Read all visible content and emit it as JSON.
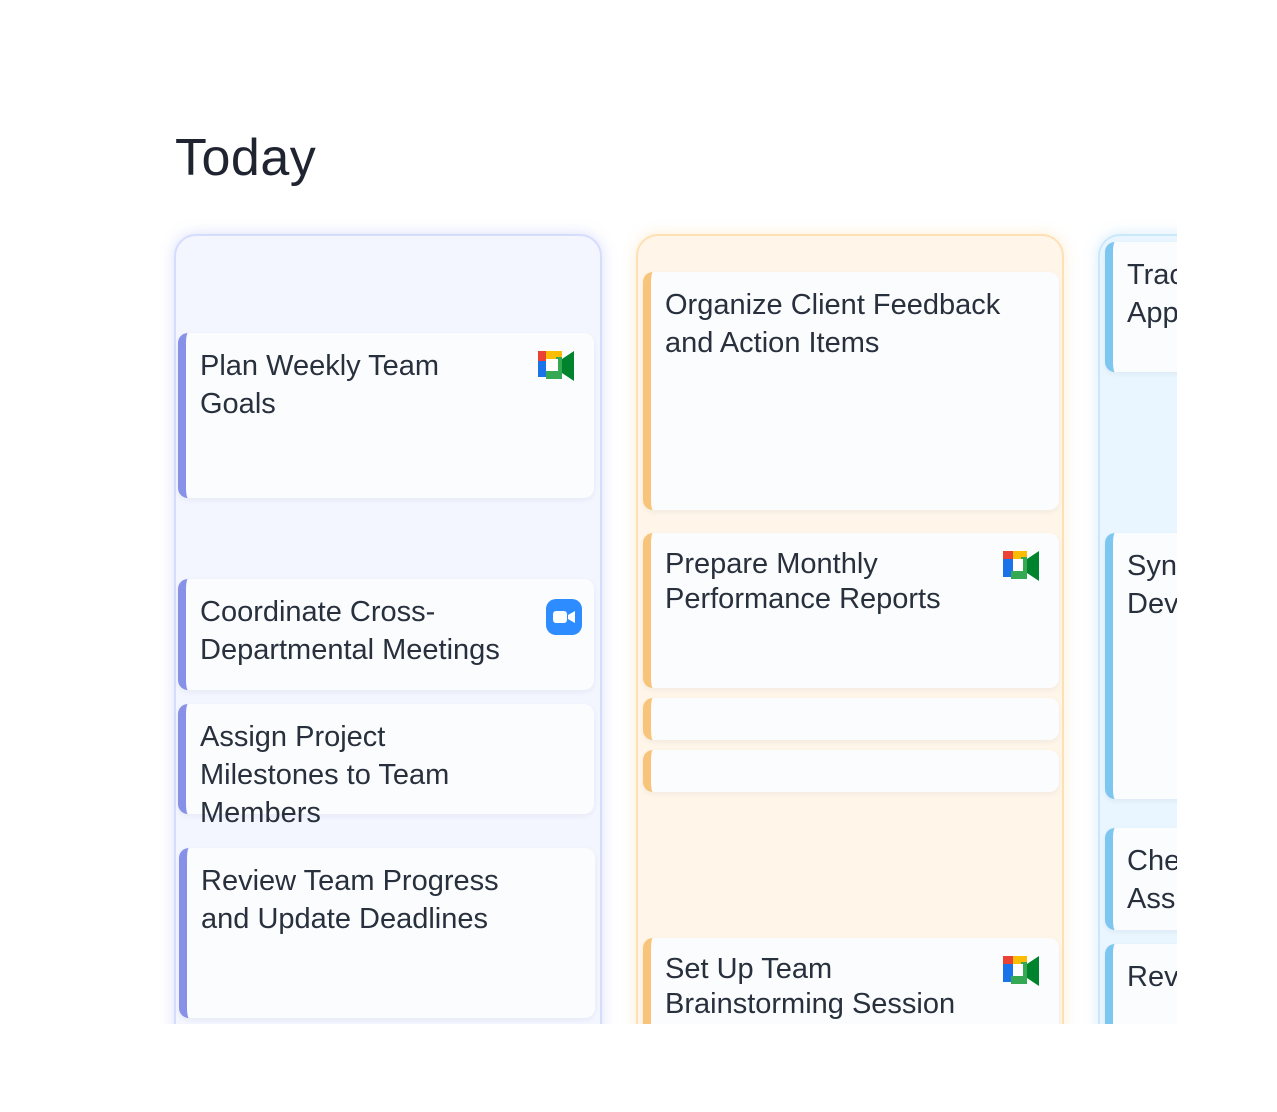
{
  "page": {
    "title": "Today"
  },
  "columns": [
    {
      "color": "#8891e8",
      "cards": [
        {
          "title": "Plan Weekly Team Goals",
          "icon": "google-meet-icon"
        },
        {
          "title": "Coordinate Cross-Departmental Meetings",
          "icon": "zoom-icon"
        },
        {
          "title": "Assign Project Milestones to Team Members",
          "icon": ""
        },
        {
          "title": "Review Team Progress and Update Deadlines",
          "icon": ""
        }
      ]
    },
    {
      "color": "#f7c47a",
      "cards": [
        {
          "title": "Organize Client Feedback and Action Items",
          "icon": ""
        },
        {
          "title": "Prepare Monthly Performance Reports",
          "icon": "google-meet-icon"
        },
        {
          "title": "",
          "icon": ""
        },
        {
          "title": "",
          "icon": ""
        },
        {
          "title": "Set Up Team Brainstorming Session",
          "icon": "google-meet-icon"
        }
      ]
    },
    {
      "color": "#7cc6ef",
      "cards": [
        {
          "title": "Trac App",
          "icon": ""
        },
        {
          "title": "Syn Dev",
          "icon": ""
        },
        {
          "title": "Che Ass",
          "icon": ""
        },
        {
          "title": "Rev",
          "icon": ""
        }
      ]
    }
  ]
}
